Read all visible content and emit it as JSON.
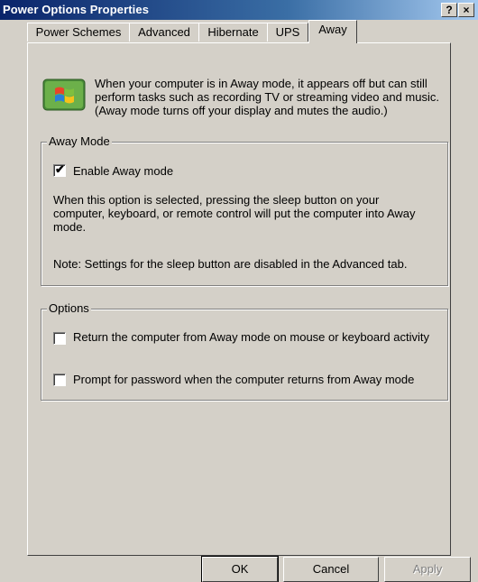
{
  "window": {
    "title": "Power Options Properties"
  },
  "titlebar_buttons": {
    "help": "?",
    "close": "×"
  },
  "tabs": [
    {
      "label": "Power Schemes"
    },
    {
      "label": "Advanced"
    },
    {
      "label": "Hibernate"
    },
    {
      "label": "UPS"
    },
    {
      "label": "Away"
    }
  ],
  "active_tab": "Away",
  "intro": {
    "icon": "windows-flag-icon",
    "text": "When your computer is in Away mode, it appears off but can still perform tasks such as recording TV or streaming video and music. (Away mode turns off your display and mutes the audio.)"
  },
  "away_mode": {
    "legend": "Away Mode",
    "enable_label": "Enable Away mode",
    "enable_checked": true,
    "description": "When this option is selected, pressing the sleep button on your computer, keyboard, or remote control will put the computer into Away mode.",
    "note": "Note: Settings for the sleep button are disabled in the Advanced tab."
  },
  "options": {
    "legend": "Options",
    "return_label": "Return the computer from Away mode on mouse or keyboard activity",
    "return_checked": false,
    "password_label": "Prompt for password when the computer returns from Away mode",
    "password_checked": false
  },
  "buttons": {
    "ok": "OK",
    "cancel": "Cancel",
    "apply": "Apply"
  }
}
